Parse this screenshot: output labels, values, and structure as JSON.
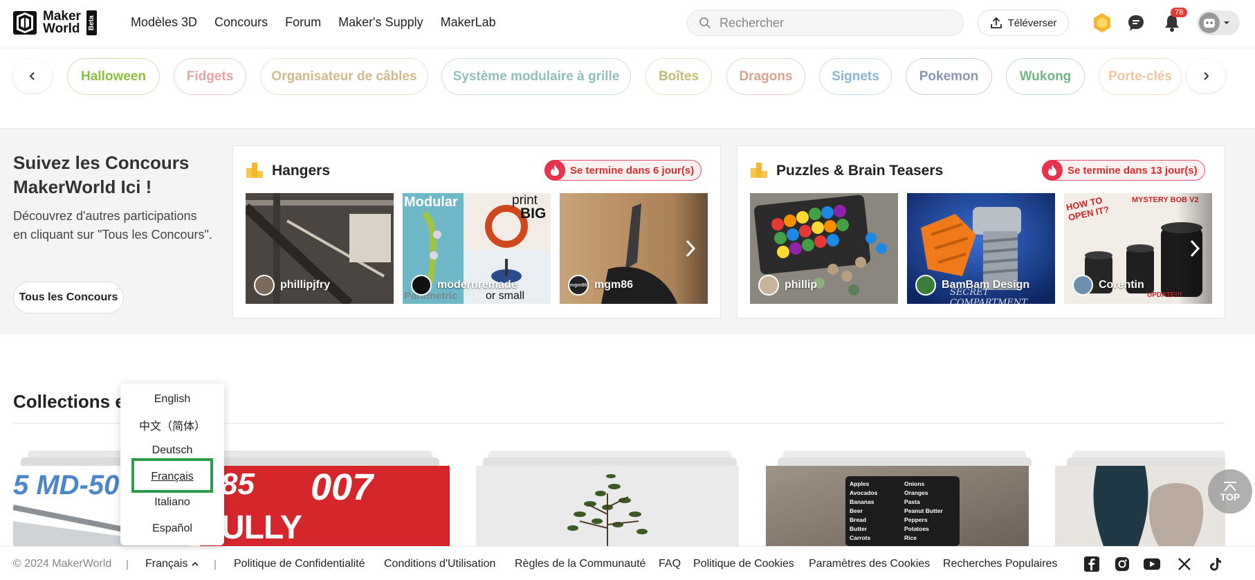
{
  "header": {
    "logo_line1": "Maker",
    "logo_line2": "World",
    "logo_badge": "Beta",
    "nav": [
      "Modèles 3D",
      "Concours",
      "Forum",
      "Maker's Supply",
      "MakerLab"
    ],
    "search_placeholder": "Rechercher",
    "upload_label": "Téléverser",
    "notification_count": "78"
  },
  "tags": {
    "items": [
      {
        "label": "Halloween",
        "color": "#8cbf3f"
      },
      {
        "label": "Fidgets",
        "color": "#e8a3a3"
      },
      {
        "label": "Organisateur de câbles",
        "color": "#d9c59a"
      },
      {
        "label": "Système modulaire à grille",
        "color": "#8fc1ba"
      },
      {
        "label": "Boîtes",
        "color": "#cbc78a"
      },
      {
        "label": "Dragons",
        "color": "#d6a28d"
      },
      {
        "label": "Signets",
        "color": "#8ab7d6"
      },
      {
        "label": "Pokemon",
        "color": "#8896b8"
      },
      {
        "label": "Wukong",
        "color": "#74b784"
      },
      {
        "label": "Porte-clés",
        "color": "#f0c7a0"
      }
    ],
    "prev_icon": "chevron-left-icon",
    "next_icon": "chevron-right-icon"
  },
  "contest": {
    "title": "Suivez les Concours MakerWorld Ici !",
    "description": "Découvrez d'autres participations en cliquant sur \"Tous les Concours\".",
    "button": "Tous les Concours",
    "cards": [
      {
        "title": "Hangers",
        "deadline": "Se termine dans 6 jour(s)",
        "entries": [
          {
            "author": "phillipjfry"
          },
          {
            "author": "modernremade",
            "overlay_top": "Modular",
            "overlay_print": "print",
            "overlay_big": "BIG",
            "overlay_bottom": "Parametric",
            "overlay_small": "or small"
          },
          {
            "author": "mgm86",
            "avatar_text": "mgm86"
          }
        ]
      },
      {
        "title": "Puzzles & Brain Teasers",
        "deadline": "Se termine dans 13 jour(s)",
        "entries": [
          {
            "author": "phillip"
          },
          {
            "author": "BamBam Design",
            "overlay_caption": "SECRET COMPARTMENT"
          },
          {
            "author": "Corentin",
            "overlay_how": "HOW TO OPEN IT?",
            "overlay_mystery": "MYSTERY BOB V2",
            "overlay_update": "UPDATE!!!"
          }
        ]
      }
    ]
  },
  "collections": {
    "title": "Collections e",
    "card1_text": "5 MD-50",
    "card2_text1": "85",
    "card2_text2": "007",
    "card2_text3": "ULLY FUNCTIONAL",
    "grocery_left": [
      "Apples",
      "Avocados",
      "Bananas",
      "Beer",
      "Bread",
      "Butter",
      "Carrots"
    ],
    "grocery_right": [
      "Onions",
      "Oranges",
      "Pasta",
      "Peanut Butter",
      "Peppers",
      "Potatoes",
      "Rice"
    ]
  },
  "language_menu": {
    "items": [
      "English",
      "中文（简体）",
      "Deutsch",
      "Français",
      "Italiano",
      "Español"
    ],
    "selected": "Français"
  },
  "footer": {
    "copyright": "© 2024 MakerWorld",
    "language": "Français",
    "links": [
      "Politique de Confidentialité",
      "Conditions d'Utilisation",
      "Règles de la Communauté",
      "FAQ",
      "Politique de Cookies",
      "Paramètres des Cookies",
      "Recherches Populaires"
    ],
    "social": [
      "facebook-icon",
      "instagram-icon",
      "youtube-icon",
      "x-icon",
      "tiktok-icon"
    ]
  },
  "top_button": "TOP"
}
